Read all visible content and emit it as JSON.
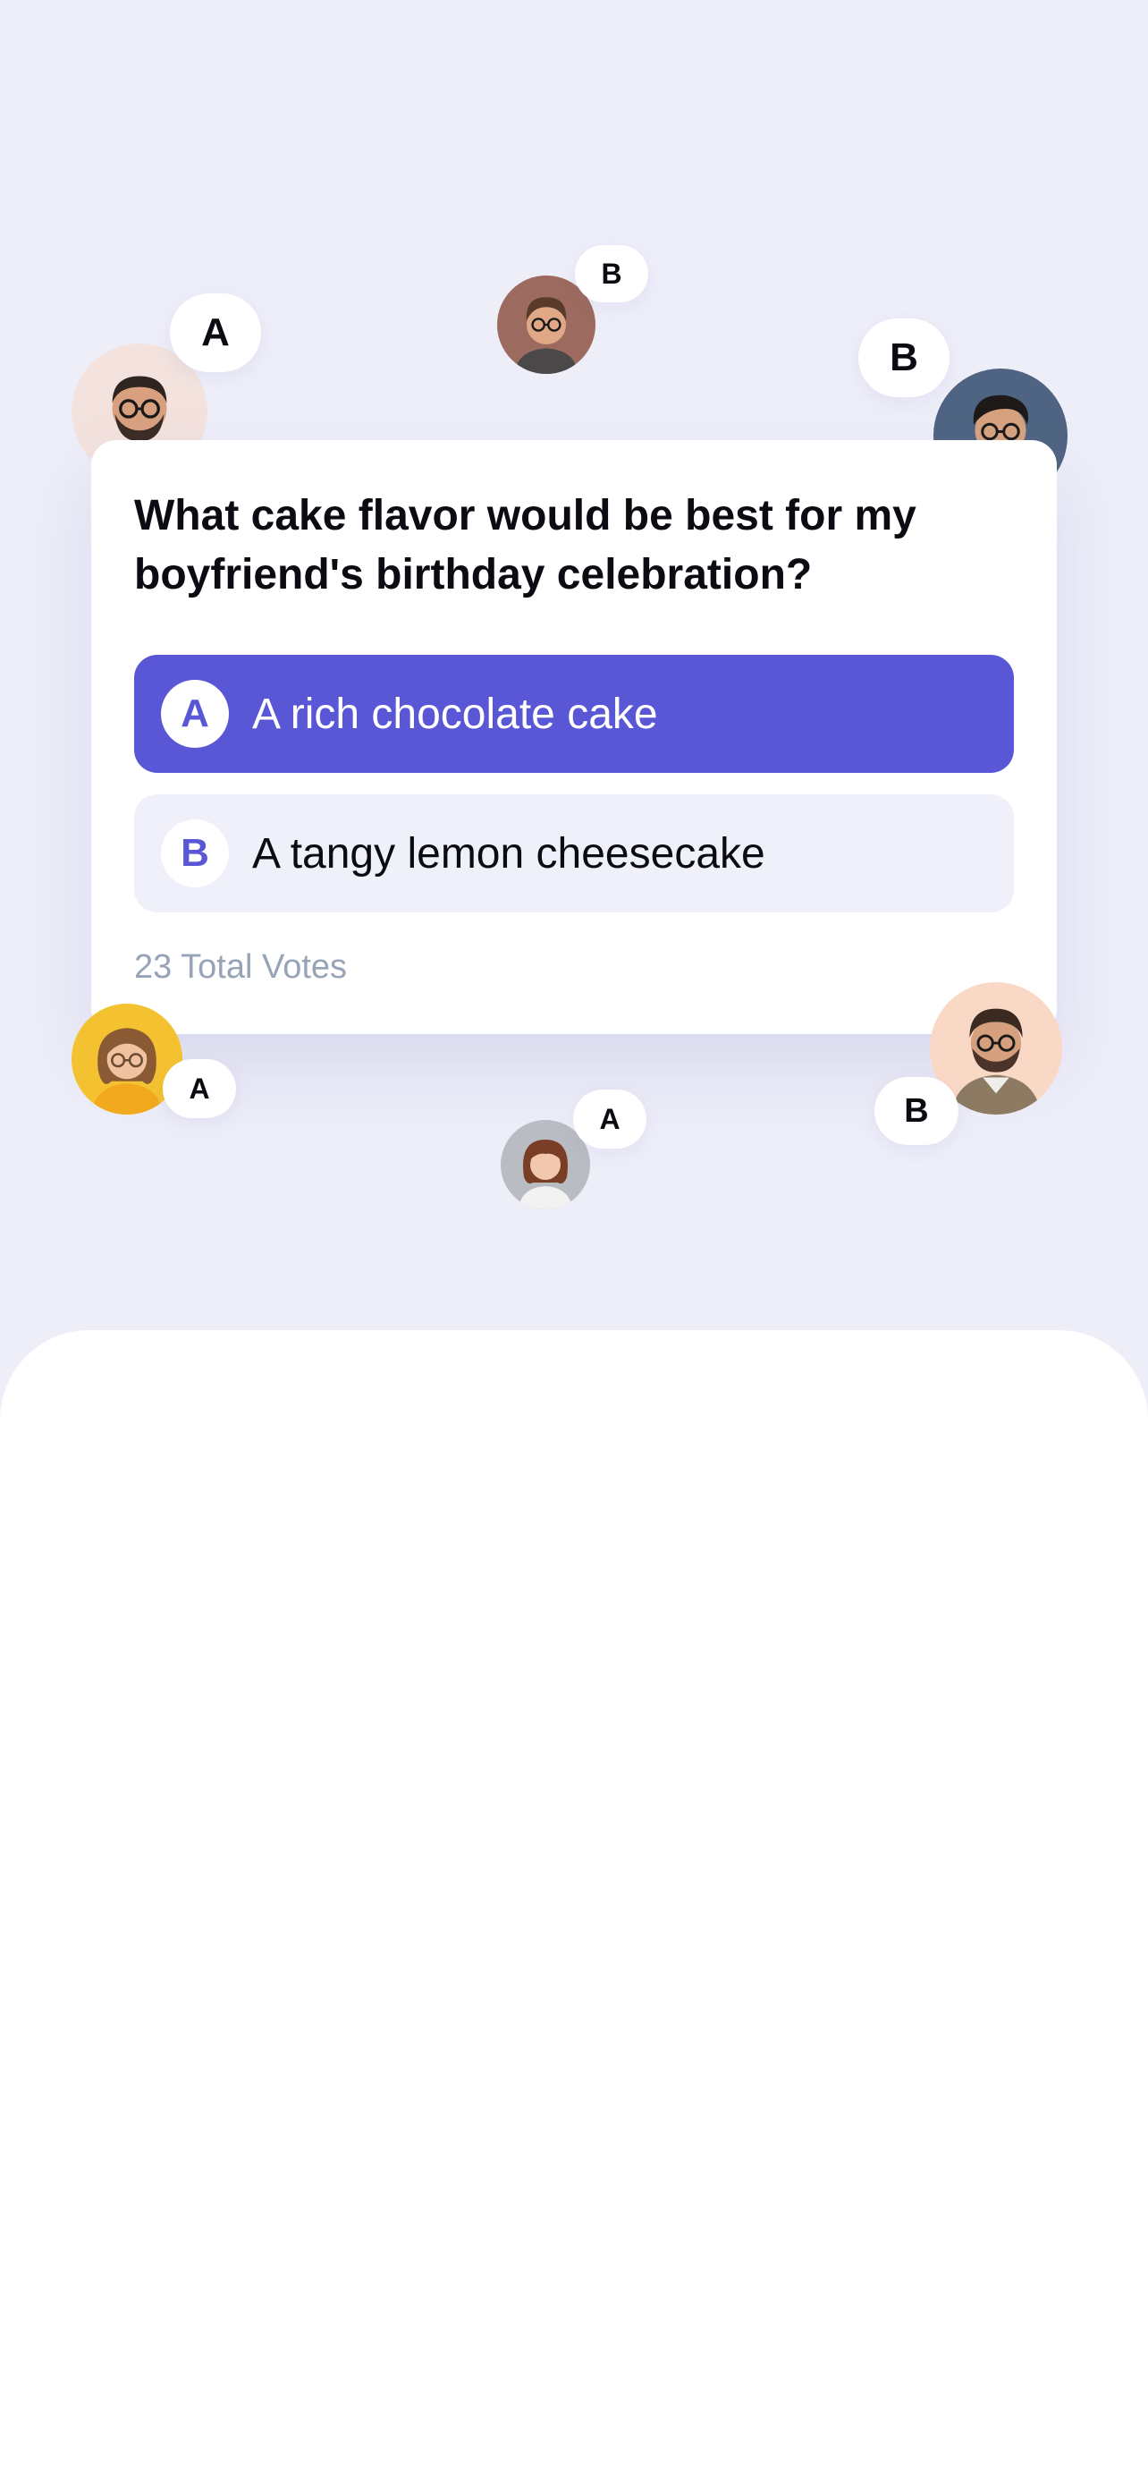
{
  "poll": {
    "question": "What cake flavor would be best for my boyfriend's birthday celebration?",
    "options": [
      {
        "letter": "A",
        "text": "A rich chocolate cake",
        "selected": true
      },
      {
        "letter": "B",
        "text": "A tangy lemon cheesecake",
        "selected": false
      }
    ],
    "total_votes": "23 Total Votes"
  },
  "voters": [
    {
      "vote": "A",
      "avatar_bg": "#F3E2DD"
    },
    {
      "vote": "B",
      "avatar_bg": "#9C6A5E"
    },
    {
      "vote": "B",
      "avatar_bg": "#4F6482"
    },
    {
      "vote": "A",
      "avatar_bg": "#F4C230"
    },
    {
      "vote": "A",
      "avatar_bg": "#B9BCC2"
    },
    {
      "vote": "B",
      "avatar_bg": "#FAD8C6"
    }
  ],
  "colors": {
    "background": "#EEEEF9",
    "accent": "#5957D6",
    "option_unselected_bg": "#EFF0FA",
    "muted_text": "#97A3B6",
    "text": "#0B0B12"
  },
  "icons": [
    "person-avatar-icon"
  ]
}
